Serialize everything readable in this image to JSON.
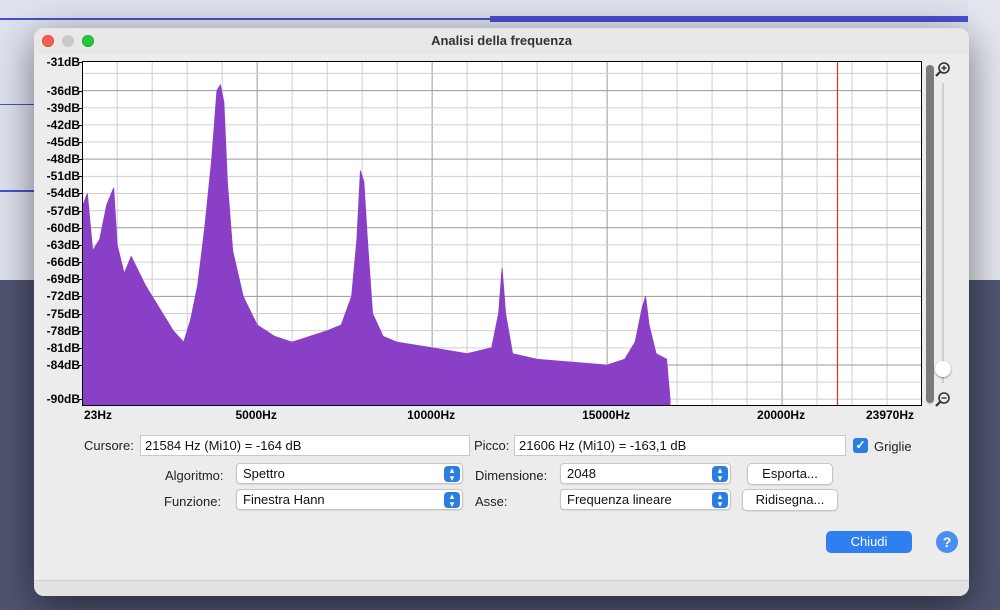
{
  "window": {
    "title": "Analisi della frequenza"
  },
  "chart_data": {
    "type": "area",
    "xlabel": "",
    "ylabel": "",
    "xlim": [
      23,
      23970
    ],
    "ylim": [
      -91,
      -31
    ],
    "x_tick_labels": [
      "23Hz",
      "5000Hz",
      "10000Hz",
      "15000Hz",
      "20000Hz",
      "23970Hz"
    ],
    "y_tick_labels": [
      "-31dB",
      "-36dB",
      "-39dB",
      "-42dB",
      "-45dB",
      "-48dB",
      "-51dB",
      "-54dB",
      "-57dB",
      "-60dB",
      "-63dB",
      "-66dB",
      "-69dB",
      "-72dB",
      "-75dB",
      "-78dB",
      "-81dB",
      "-84dB",
      "-90dB"
    ],
    "color": "#8a3fc7",
    "grid": true,
    "cursor_line_hz": 21584,
    "series": [
      {
        "points": [
          [
            23,
            -56
          ],
          [
            150,
            -54
          ],
          [
            300,
            -64
          ],
          [
            500,
            -62
          ],
          [
            700,
            -56
          ],
          [
            900,
            -53
          ],
          [
            1000,
            -63
          ],
          [
            1200,
            -68
          ],
          [
            1400,
            -65
          ],
          [
            1800,
            -70
          ],
          [
            2000,
            -72
          ],
          [
            2300,
            -75
          ],
          [
            2600,
            -78
          ],
          [
            2900,
            -80
          ],
          [
            3100,
            -76
          ],
          [
            3300,
            -70
          ],
          [
            3500,
            -60
          ],
          [
            3700,
            -48
          ],
          [
            3850,
            -36
          ],
          [
            3950,
            -35
          ],
          [
            4050,
            -38
          ],
          [
            4150,
            -52
          ],
          [
            4300,
            -64
          ],
          [
            4600,
            -72
          ],
          [
            5000,
            -77
          ],
          [
            5500,
            -79
          ],
          [
            6000,
            -80
          ],
          [
            6500,
            -79
          ],
          [
            7000,
            -78
          ],
          [
            7400,
            -77
          ],
          [
            7700,
            -72
          ],
          [
            7850,
            -62
          ],
          [
            7950,
            -50
          ],
          [
            8050,
            -52
          ],
          [
            8150,
            -62
          ],
          [
            8300,
            -75
          ],
          [
            8600,
            -79
          ],
          [
            9000,
            -80
          ],
          [
            10000,
            -81
          ],
          [
            11000,
            -82
          ],
          [
            11700,
            -81
          ],
          [
            11900,
            -75
          ],
          [
            12000,
            -67
          ],
          [
            12100,
            -75
          ],
          [
            12300,
            -82
          ],
          [
            13000,
            -83
          ],
          [
            14000,
            -83.5
          ],
          [
            15000,
            -84
          ],
          [
            15500,
            -83
          ],
          [
            15800,
            -80
          ],
          [
            16000,
            -74
          ],
          [
            16100,
            -72
          ],
          [
            16200,
            -77
          ],
          [
            16400,
            -82
          ],
          [
            16700,
            -83
          ],
          [
            16800,
            -90
          ]
        ]
      }
    ]
  },
  "cursor": {
    "label": "Cursore:",
    "value": "21584 Hz (Mi10) = -164 dB"
  },
  "peak": {
    "label": "Picco:",
    "value": "21606 Hz (Mi10) = -163,1 dB"
  },
  "grid_checkbox": {
    "label": "Griglie",
    "checked": true
  },
  "algorithm": {
    "label": "Algoritmo:",
    "value": "Spettro"
  },
  "function": {
    "label": "Funzione:",
    "value": "Finestra Hann"
  },
  "size": {
    "label": "Dimensione:",
    "value": "2048"
  },
  "axis": {
    "label": "Asse:",
    "value": "Frequenza lineare"
  },
  "buttons": {
    "export": "Esporta...",
    "redraw": "Ridisegna...",
    "close": "Chiudi",
    "help": "?"
  }
}
